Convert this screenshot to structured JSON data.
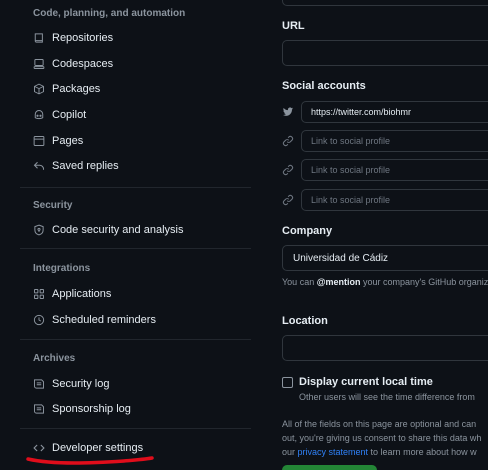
{
  "sidebar": {
    "section_code": "Code, planning, and automation",
    "code_items": [
      {
        "label": "Repositories",
        "icon": "repo-icon"
      },
      {
        "label": "Codespaces",
        "icon": "codespaces-icon"
      },
      {
        "label": "Packages",
        "icon": "package-icon"
      },
      {
        "label": "Copilot",
        "icon": "copilot-icon"
      },
      {
        "label": "Pages",
        "icon": "browser-icon"
      },
      {
        "label": "Saved replies",
        "icon": "reply-icon"
      }
    ],
    "section_security": "Security",
    "security_items": [
      {
        "label": "Code security and analysis",
        "icon": "shield-lock-icon"
      }
    ],
    "section_integrations": "Integrations",
    "integration_items": [
      {
        "label": "Applications",
        "icon": "apps-icon"
      },
      {
        "label": "Scheduled reminders",
        "icon": "clock-icon"
      }
    ],
    "section_archives": "Archives",
    "archive_items": [
      {
        "label": "Security log",
        "icon": "log-icon"
      },
      {
        "label": "Sponsorship log",
        "icon": "log-icon"
      }
    ],
    "developer_settings": {
      "label": "Developer settings",
      "icon": "code-icon"
    },
    "underline_color": "#e00d1b"
  },
  "form": {
    "url_label": "URL",
    "url_value": "",
    "social_label": "Social accounts",
    "social_accounts": [
      {
        "value": "https://twitter.com/biohmr",
        "icon": "twitter-icon"
      },
      {
        "placeholder": "Link to social profile",
        "icon": "link-icon"
      },
      {
        "placeholder": "Link to social profile",
        "icon": "link-icon"
      },
      {
        "placeholder": "Link to social profile",
        "icon": "link-icon"
      }
    ],
    "company_label": "Company",
    "company_value": "Universidad de Cádiz",
    "company_note_prefix": "You can ",
    "company_note_mention": "@mention",
    "company_note_suffix": " your company's GitHub organiz",
    "location_label": "Location",
    "location_value": "",
    "local_time_label": "Display current local time",
    "local_time_note": "Other users will see the time difference from",
    "privacy_line1": "All of the fields on this page are optional and can",
    "privacy_line2": "out, you're giving us consent to share this data wh",
    "privacy_line3_prefix": "our ",
    "privacy_link": "privacy statement",
    "privacy_line3_suffix": " to learn more about how w"
  },
  "colors": {
    "background": "#0d1117",
    "border": "#30363d",
    "text": "#e6edf3",
    "muted": "#8b949e",
    "link": "#2f81f7",
    "primary_button": "#238636"
  }
}
